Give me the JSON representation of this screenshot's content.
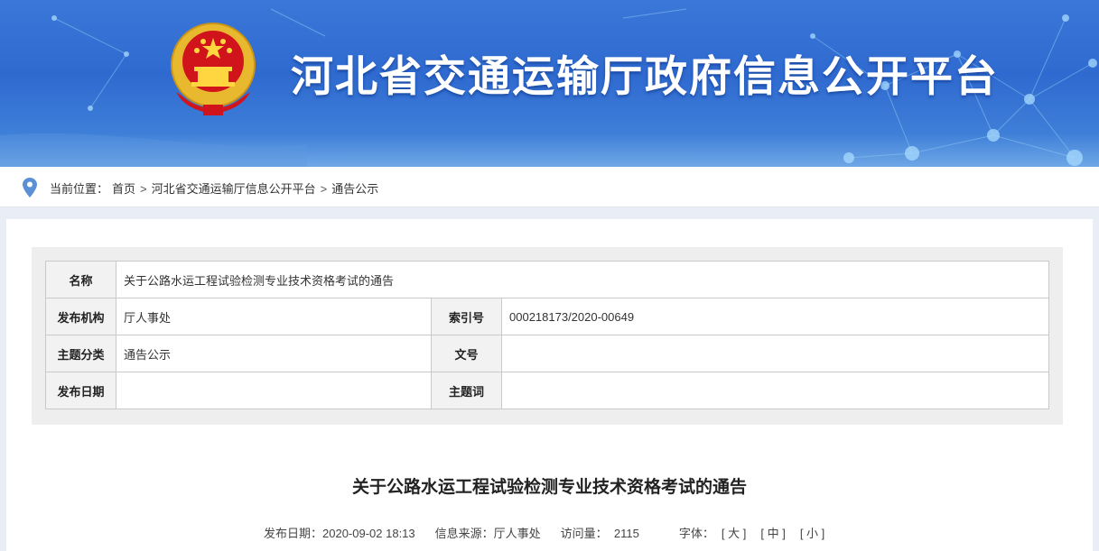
{
  "header": {
    "site_title": "河北省交通运输厅政府信息公开平台",
    "emblem_icon": "national-emblem-icon",
    "banner_color": "#3470d4"
  },
  "breadcrumb": {
    "icon": "location-pin-icon",
    "prefix": "当前位置：",
    "items": [
      "首页",
      "河北省交通运输厅信息公开平台",
      "通告公示"
    ],
    "separator": ">"
  },
  "meta": {
    "name_label": "名称",
    "name_value": "关于公路水运工程试验检测专业技术资格考试的通告",
    "publisher_label": "发布机构",
    "publisher_value": "厅人事处",
    "index_label": "索引号",
    "index_value": "000218173/2020-00649",
    "category_label": "主题分类",
    "category_value": "通告公示",
    "doc_no_label": "文号",
    "doc_no_value": "",
    "date_label": "发布日期",
    "date_value": "",
    "keywords_label": "主题词",
    "keywords_value": ""
  },
  "document": {
    "title": "关于公路水运工程试验检测专业技术资格考试的通告",
    "publish_date": "发布日期：2020-09-02 18:13",
    "source": "信息来源：厅人事处",
    "visits_label": "访问量：",
    "visits_value": "2115",
    "font_label": "字体：",
    "font_large": "[ 大 ]",
    "font_medium": "[ 中 ]",
    "font_small": "[ 小 ]"
  }
}
